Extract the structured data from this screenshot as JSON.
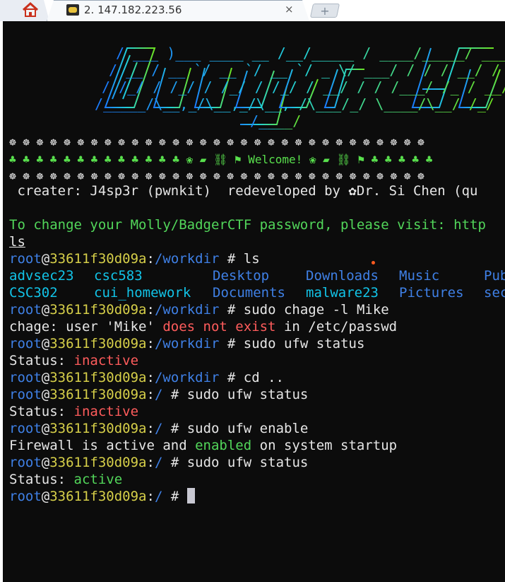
{
  "tab": {
    "title": "2. 147.182.223.56",
    "close": "×",
    "new": "+"
  },
  "terminal": {
    "banner_rows": [
      "☸ ☸ ☸ ☸ ☸ ☸ ☸ ☸ ☸ ☸ ☸ ☸ ☸ ☸ ☸ ☸ ☸ ☸ ☸ ☸ ☸ ☸ ☸ ☸ ☸ ☸ ☸ ☸ ☸ ☸ ☸",
      "♣ ♣ ♣ ♣ ♣ ♣ ♣ ♣ ♣ ♣ ♣ ♣ ♣ ❀ ▰ ⛓ ⚑ Welcome! ❀ ▰ ⛓ ⚑ ♣ ♣ ♣ ♣ ♣",
      "☸ ☸ ☸ ☸ ☸ ☸ ☸ ☸ ☸ ☸ ☸ ☸ ☸ ☸ ☸ ☸ ☸ ☸ ☸ ☸ ☸ ☸ ☸ ☸ ☸ ☸ ☸ ☸ ☸ ☸ ☸"
    ],
    "creator_line": " creater: J4sp3r (pwnkit)  redeveloped by ✿Dr. Si Chen (qu",
    "password_notice": "To change your Molly/BadgerCTF password, please visit: http",
    "ls_command": "ls",
    "prompt_user": "root",
    "prompt_host": "33611f30d09a",
    "prompt_sep": "@",
    "prompt_colon": ":",
    "prompt_workdir": "/workdir",
    "prompt_root": "/",
    "prompt_symbol": " #",
    "cmd_ls": " ls",
    "dirs_row1": [
      "advsec23",
      "csc583",
      "Desktop",
      "Downloads",
      "Music",
      "Pub"
    ],
    "dirs_row2": [
      "CSC302",
      "cui_homework",
      "Documents",
      "malware23",
      "Pictures",
      "sec"
    ],
    "cmd_chage": " sudo chage -l Mike",
    "chage_prefix": "chage: user 'Mike' ",
    "chage_error": "does not exist",
    "chage_suffix": " in /etc/passwd",
    "cmd_ufw_status": " sudo ufw status",
    "status_label": "Status: ",
    "status_inactive": "inactive",
    "cmd_cd": " cd ..",
    "cmd_ufw_enable": " sudo ufw enable",
    "firewall_prefix": "Firewall is active and ",
    "firewall_enabled": "enabled",
    "firewall_suffix": " on system startup",
    "status_active": "active"
  }
}
